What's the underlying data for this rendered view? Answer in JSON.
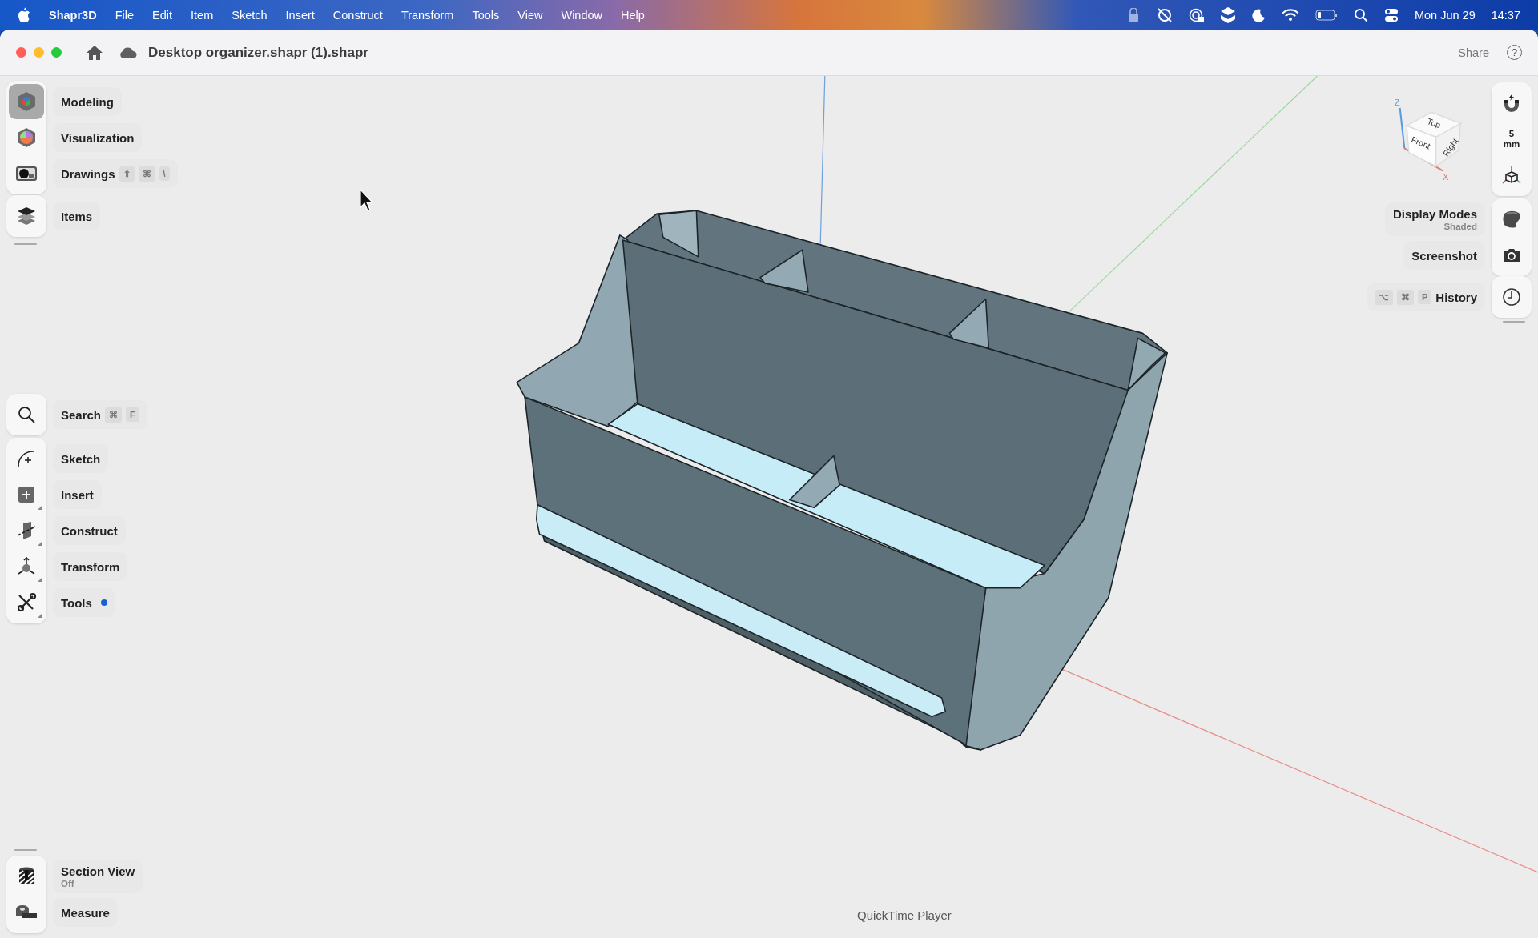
{
  "menu_bar": {
    "app": "Shapr3D",
    "menus": [
      "File",
      "Edit",
      "Item",
      "Sketch",
      "Insert",
      "Construct",
      "Transform",
      "Tools",
      "View",
      "Window",
      "Help"
    ],
    "date": "Mon Jun 29",
    "time": "14:37"
  },
  "window": {
    "title": "Desktop organizer.shapr (1).shapr",
    "share": "Share",
    "help": "?"
  },
  "left_toolbar": {
    "workspaces": [
      {
        "kind": "modeling",
        "label": "Modeling",
        "selected": true
      },
      {
        "kind": "visualization",
        "label": "Visualization",
        "selected": false
      },
      {
        "kind": "drawings",
        "label": "Drawings",
        "selected": false,
        "shortcut": [
          "⇧",
          "⌘",
          "\\"
        ]
      }
    ],
    "items": {
      "kind": "items",
      "label": "Items"
    },
    "search": {
      "kind": "search",
      "label": "Search",
      "shortcut": [
        "⌘",
        "F"
      ]
    },
    "tools": [
      {
        "kind": "sketch",
        "label": "Sketch",
        "submenu": false,
        "dot": false
      },
      {
        "kind": "insert",
        "label": "Insert",
        "submenu": true,
        "dot": false
      },
      {
        "kind": "construct",
        "label": "Construct",
        "submenu": true,
        "dot": false
      },
      {
        "kind": "transform",
        "label": "Transform",
        "submenu": true,
        "dot": false
      },
      {
        "kind": "tools",
        "label": "Tools",
        "submenu": true,
        "dot": true
      }
    ],
    "bottom": [
      {
        "kind": "section",
        "label": "Section View",
        "value": "Off"
      },
      {
        "kind": "measure",
        "label": "Measure"
      }
    ]
  },
  "right_toolbar": {
    "grid_value": "5",
    "grid_unit": "mm",
    "display_modes": {
      "label": "Display Modes",
      "value": "Shaded"
    },
    "screenshot": {
      "label": "Screenshot"
    },
    "history": {
      "label": "History",
      "shortcut": [
        "⌥",
        "⌘",
        "P"
      ]
    }
  },
  "view_cube": {
    "faces": [
      "Top",
      "Front",
      "Right"
    ],
    "axes": [
      "Z",
      "X"
    ]
  },
  "dock_tooltip": "QuickTime Player"
}
